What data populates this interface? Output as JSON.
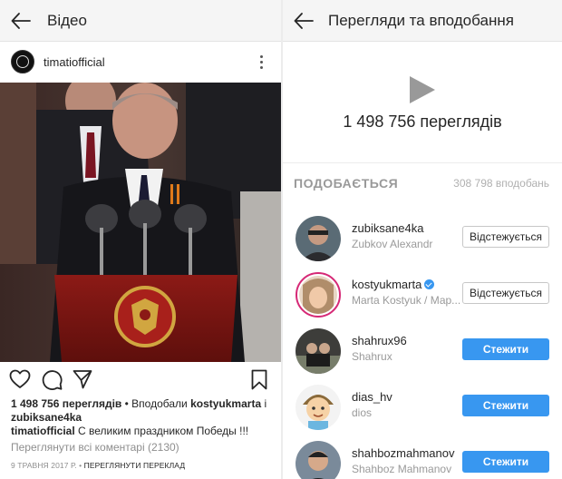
{
  "left_panel": {
    "title": "Відео",
    "post_username": "timatiofficial",
    "views_text": "1 498 756 переглядів",
    "liked_by_prefix": " • Вподобали ",
    "liked_by_user": "kostyukmarta",
    "liked_by_and": " і",
    "liked_by_second": "zubiksane4ka",
    "caption_user": "timatiofficial",
    "caption_text": " С великим праздником Победы !!!",
    "comments_link": "Переглянути всі коментарі (2130)",
    "date": "9 ТРАВНЯ 2017 Р.",
    "meta_sep": " • ",
    "translation_link": "ПЕРЕГЛЯНУТИ ПЕРЕКЛАД"
  },
  "right_panel": {
    "title": "Перегляди та вподобання",
    "views_count": "1 498 756 переглядів",
    "likes_header": "ПОДОБАЄТЬСЯ",
    "likes_count": "308 798 вподобань",
    "users": [
      {
        "username": "zubiksane4ka",
        "full_name": "Zubkov Alexandr",
        "button": "Відстежується",
        "following": true,
        "story": false,
        "verified": false
      },
      {
        "username": "kostyukmarta",
        "full_name": "Marta Kostyuk / Мар...",
        "button": "Відстежується",
        "following": true,
        "story": true,
        "verified": true
      },
      {
        "username": "shahrux96",
        "full_name": "Shahrux",
        "button": "Стежити",
        "following": false,
        "story": false,
        "verified": false
      },
      {
        "username": "dias_hv",
        "full_name": "dios",
        "button": "Стежити",
        "following": false,
        "story": false,
        "verified": false
      },
      {
        "username": "shahbozmahmanov",
        "full_name": "Shahboz Mahmanov",
        "button": "Стежити",
        "following": false,
        "story": false,
        "verified": false
      }
    ]
  },
  "colors": {
    "accent": "#3897f0",
    "story_ring": "#d62976",
    "appbar_bg": "#f5f5f5",
    "muted_text": "#8e8e8e"
  },
  "icons": {
    "back": "arrow-left-icon",
    "more": "more-vertical-icon",
    "like": "heart-icon",
    "comment": "comment-icon",
    "share": "send-icon",
    "save": "bookmark-icon",
    "play": "play-icon",
    "verified": "verified-badge-icon"
  }
}
